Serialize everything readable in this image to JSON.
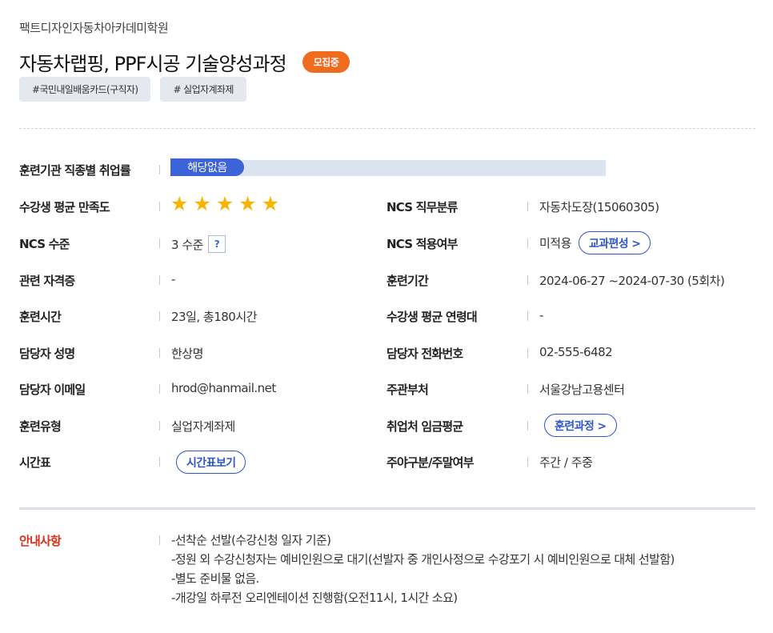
{
  "header": {
    "institute": "팩트디자인자동차아카데미학원",
    "course_title": "자동차랩핑, PPF시공 기술양성과정",
    "status_badge": "모집중",
    "tags": [
      "#국민내일배움카드(구직자)",
      "# 실업자계좌제"
    ]
  },
  "details": {
    "employment_rate": {
      "label": "훈련기관 직종별 취업률",
      "value": "해당없음"
    },
    "satisfaction": {
      "label": "수강생 평균 만족도",
      "stars": 5
    },
    "ncs_category": {
      "label": "NCS 직무분류",
      "value": "자동차도장(15060305)"
    },
    "ncs_level": {
      "label": "NCS 수준",
      "value": "3 수준",
      "help_icon": "?"
    },
    "ncs_applied": {
      "label": "NCS 적용여부",
      "value": "미적용",
      "button": "교과편성 >"
    },
    "certificate": {
      "label": "관련 자격증",
      "value": "-"
    },
    "period": {
      "label": "훈련기간",
      "value": "2024-06-27 ~2024-07-30 (5회차)"
    },
    "hours": {
      "label": "훈련시간",
      "value": "23일, 총180시간"
    },
    "age": {
      "label": "수강생 평균 연령대",
      "value": "-"
    },
    "manager_name": {
      "label": "담당자 성명",
      "value": "한상명"
    },
    "manager_phone": {
      "label": "담당자 전화번호",
      "value": "02-555-6482"
    },
    "manager_email": {
      "label": "담당자 이메일",
      "value": "hrod@hanmail.net"
    },
    "agency": {
      "label": "주관부처",
      "value": "서울강남고용센터"
    },
    "training_type": {
      "label": "훈련유형",
      "value": "실업자계좌제"
    },
    "wage": {
      "label": "취업처 임금평균",
      "button": "훈련과정 >"
    },
    "timetable": {
      "label": "시간표",
      "button": "시간표보기"
    },
    "day_type": {
      "label": "주야구분/주말여부",
      "value": "주간 / 주중"
    }
  },
  "notice": {
    "label": "안내사항",
    "items": [
      "-선착순 선발(수강신청 일자 기준)",
      "-정원 외 수강신청자는 예비인원으로 대기(선발자 중 개인사정으로 수강포기 시 예비인원으로 대체 선발함)",
      "-별도 준비물 없음.",
      "-개강일 하루전 오리엔테이션 진행함(오전11시, 1시간 소요)"
    ]
  },
  "colors": {
    "accent": "#2f56c8",
    "badge": "#ef6c1f",
    "notice": "#d5301a",
    "star": "#f7b500"
  }
}
